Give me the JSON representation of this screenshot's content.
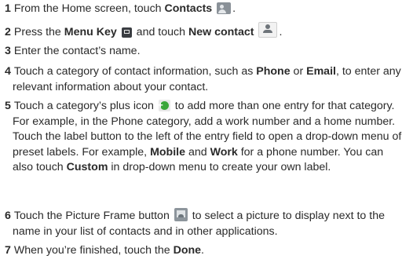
{
  "steps": [
    {
      "number": "1",
      "t1": "From the Home screen, touch ",
      "b1": "Contacts",
      "icon": "contacts-app-icon",
      "t2": "."
    },
    {
      "number": "2",
      "t1": "Press the ",
      "b1": "Menu Key",
      "icon1": "menu-key-icon",
      "t2": " and touch ",
      "b2": "New contact",
      "icon2": "new-contact-icon",
      "t3": "."
    },
    {
      "number": "3",
      "t1": "Enter the contact’s name."
    },
    {
      "number": "4",
      "t1": "Touch a category of contact information, such as ",
      "b1": "Phone",
      "t2": " or ",
      "b2": "Email",
      "t3": ", to enter any relevant information about your contact."
    },
    {
      "number": "5",
      "t1": "Touch a category’s plus icon ",
      "icon": "green-plus-icon",
      "t2": " to add more than one entry for that category. For example, in the Phone category, add a work number and a home number. Touch the label button to the left of the entry field to open a drop-down menu of preset labels. For example, ",
      "b1": "Mobile",
      "t3": " and ",
      "b2": "Work",
      "t4": " for a phone number. You can also touch ",
      "b3": "Custom",
      "t5": " in drop-down menu to create your own label."
    },
    {
      "number": "6",
      "t1": "Touch the Picture Frame button ",
      "icon": "picture-frame-icon",
      "t2": " to select a picture to display next to the name in your list of contacts and in other applications."
    },
    {
      "number": "7",
      "t1": "When you’re finished, touch the ",
      "b1": "Done",
      "t2": "."
    }
  ]
}
